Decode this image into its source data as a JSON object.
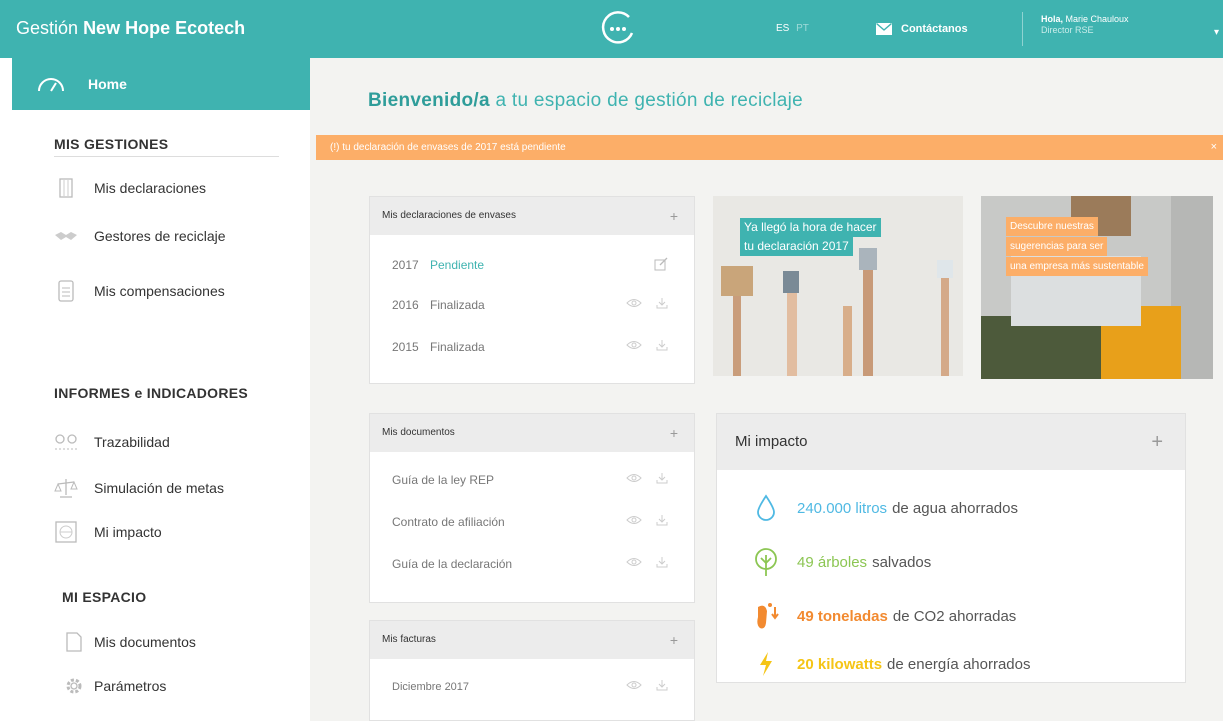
{
  "header": {
    "brand_prefix": "Gestión",
    "brand_name": "New Hope Ecotech",
    "lang_active": "ES",
    "lang_other": "PT",
    "contact": "Contáctanos",
    "greeting": "Hola,",
    "user_name": "Marie Chauloux",
    "user_role": "Director RSE"
  },
  "sidebar": {
    "home": "Home",
    "sections": [
      {
        "title": "MIS GESTIONES",
        "items": [
          "Mis declaraciones",
          "Gestores de reciclaje",
          "Mis compensaciones"
        ]
      },
      {
        "title": "INFORMES e INDICADORES",
        "items": [
          "Trazabilidad",
          "Simulación de metas",
          "Mi impacto"
        ]
      },
      {
        "title": "MI ESPACIO",
        "items": [
          "Mis documentos",
          "Parámetros"
        ]
      }
    ]
  },
  "main": {
    "welcome_bold": "Bienvenido/a",
    "welcome_rest": "a tu espacio de gestión de reciclaje",
    "alert": "(!) tu declaración de envases de 2017 está pendiente",
    "alert_close": "×"
  },
  "declaraciones": {
    "title": "Mis declaraciones de envases",
    "rows": [
      {
        "year": "2017",
        "status": "Pendiente"
      },
      {
        "year": "2016",
        "status": "Finalizada"
      },
      {
        "year": "2015",
        "status": "Finalizada"
      }
    ]
  },
  "documentos": {
    "title": "Mis documentos",
    "rows": [
      "Guía de la ley REP",
      "Contrato de afiliación",
      "Guía de la declaración"
    ]
  },
  "facturas": {
    "title": "Mis facturas",
    "rows": [
      "Diciembre 2017"
    ]
  },
  "promos": {
    "declaracion_line1": "Ya llegó la hora de hacer",
    "declaracion_line2": "tu declaración 2017",
    "sugerencias_line1": "Descubre nuestras",
    "sugerencias_line2": "sugerencias para ser",
    "sugerencias_line3": "una empresa más sustentable"
  },
  "impacto": {
    "title": "Mi impacto",
    "rows": [
      {
        "value": "240.000 litros",
        "rest": "de agua ahorrados",
        "icon": "water-drop-icon",
        "color": "#4fb9e3"
      },
      {
        "value": "49 árboles",
        "rest": "salvados",
        "icon": "tree-icon",
        "color": "#8cc653"
      },
      {
        "value": "49 toneladas",
        "rest": "de CO2 ahorradas",
        "icon": "footprint-icon",
        "color": "#f28a30"
      },
      {
        "value": "20 kilowatts",
        "rest": "de energía ahorrados",
        "icon": "lightning-icon",
        "color": "#f5c516"
      }
    ]
  },
  "colors": {
    "accent": "#3fb3b0",
    "alert": "#fcae68"
  }
}
